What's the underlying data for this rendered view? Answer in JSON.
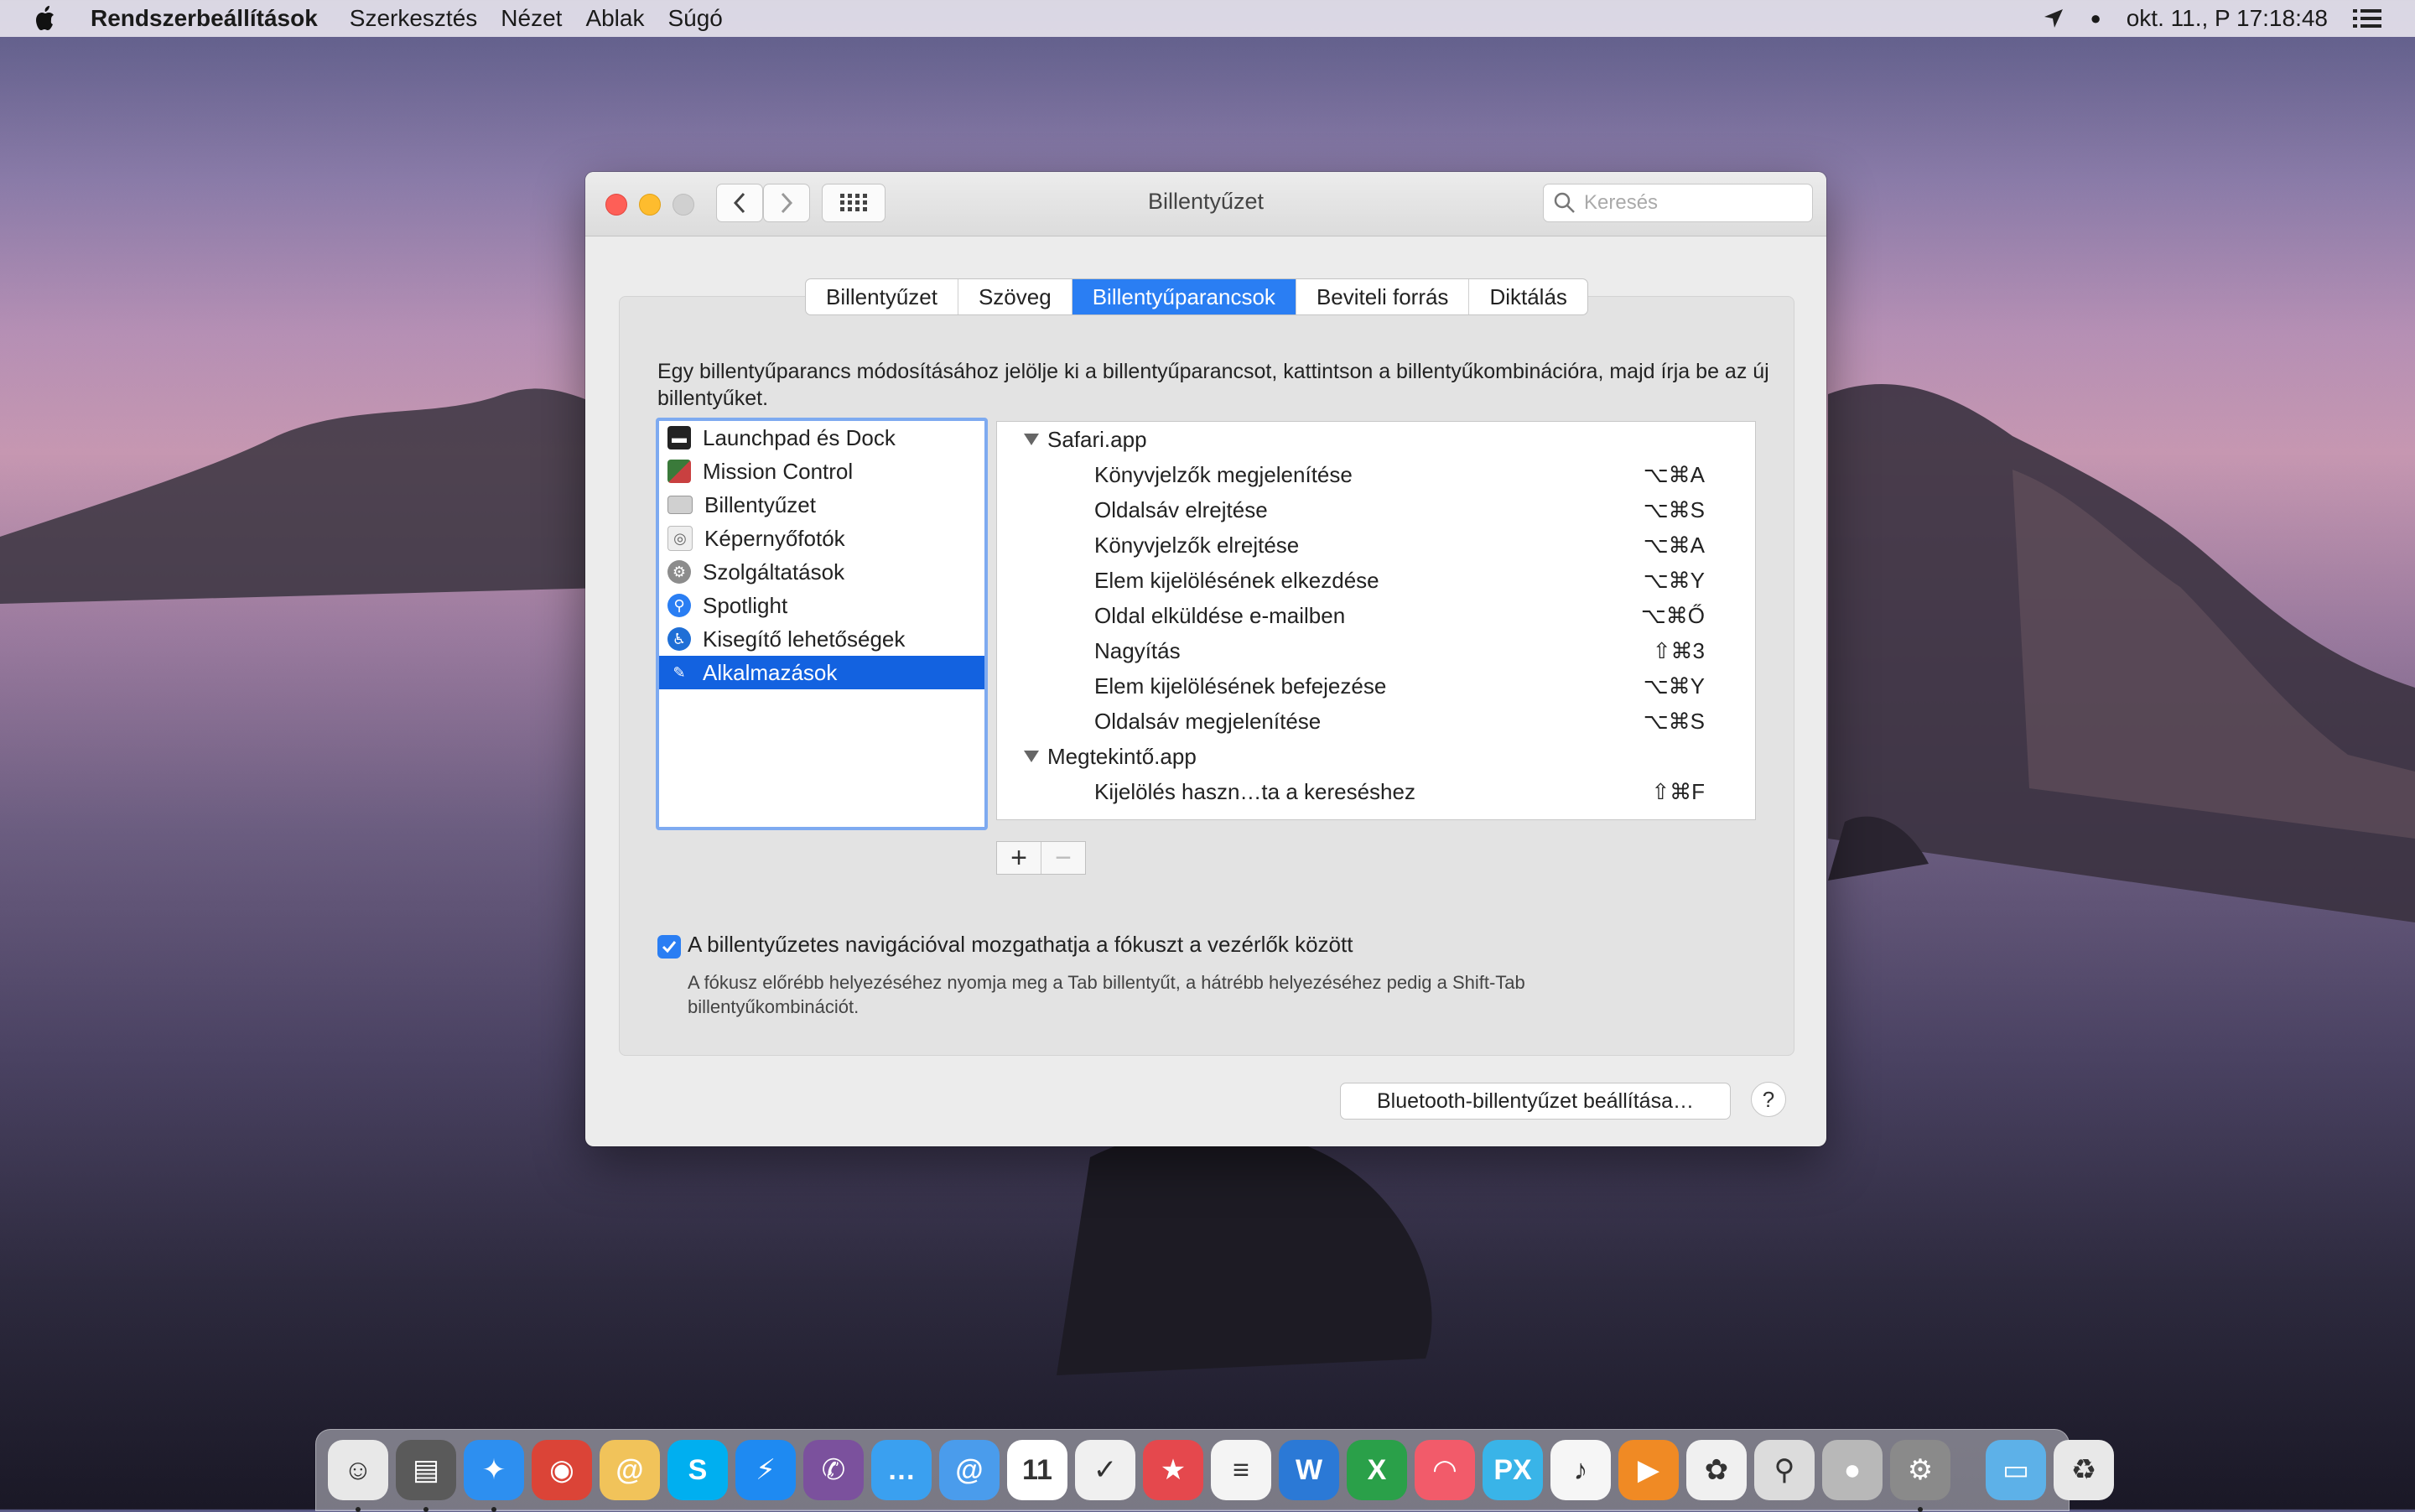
{
  "menubar": {
    "app_name": "Rendszerbeállítások",
    "menus": [
      "Szerkesztés",
      "Nézet",
      "Ablak",
      "Súgó"
    ],
    "clock": "okt. 11., P  17:18:48"
  },
  "window": {
    "title": "Billentyűzet",
    "search_placeholder": "Keresés",
    "tabs": [
      "Billentyűzet",
      "Szöveg",
      "Billentyűparancsok",
      "Beviteli forrás",
      "Diktálás"
    ],
    "active_tab": "Billentyűparancsok",
    "description": "Egy billentyűparancs módosításához jelölje ki a billentyűparancsot, kattintson a billentyűkombinációra, majd írja be az új billentyűket.",
    "categories": [
      {
        "label": "Launchpad és Dock",
        "icon": "launchpad-icon",
        "color": "#222222"
      },
      {
        "label": "Mission Control",
        "icon": "mission-control-icon",
        "color": "#3a7a3a"
      },
      {
        "label": "Billentyűzet",
        "icon": "keyboard-icon",
        "color": "#bdbdbd"
      },
      {
        "label": "Képernyőfotók",
        "icon": "screenshot-icon",
        "color": "#d8d8d8"
      },
      {
        "label": "Szolgáltatások",
        "icon": "gear-icon",
        "color": "#8c8c8c"
      },
      {
        "label": "Spotlight",
        "icon": "spotlight-icon",
        "color": "#2a7ef3"
      },
      {
        "label": "Kisegítő lehetőségek",
        "icon": "accessibility-icon",
        "color": "#1f6fd6"
      },
      {
        "label": "Alkalmazások",
        "icon": "app-store-icon",
        "color": "#3a88ee"
      }
    ],
    "selected_category": "Alkalmazások",
    "shortcuts": [
      {
        "type": "group",
        "label": "Safari.app"
      },
      {
        "type": "item",
        "label": "Könyvjelzők megjelenítése",
        "key": "⌥⌘A"
      },
      {
        "type": "item",
        "label": "Oldalsáv elrejtése",
        "key": "⌥⌘S"
      },
      {
        "type": "item",
        "label": "Könyvjelzők elrejtése",
        "key": "⌥⌘A"
      },
      {
        "type": "item",
        "label": "Elem kijelölésének elkezdése",
        "key": "⌥⌘Y"
      },
      {
        "type": "item",
        "label": "Oldal elküldése e-mailben",
        "key": "⌥⌘Ő"
      },
      {
        "type": "item",
        "label": "Nagyítás",
        "key": "⇧⌘3"
      },
      {
        "type": "item",
        "label": "Elem kijelölésének befejezése",
        "key": "⌥⌘Y"
      },
      {
        "type": "item",
        "label": "Oldalsáv megjelenítése",
        "key": "⌥⌘S"
      },
      {
        "type": "group",
        "label": "Megtekintő.app"
      },
      {
        "type": "item",
        "label": "Kijelölés haszn…ta a kereséshez",
        "key": "⇧⌘F"
      }
    ],
    "add_label": "+",
    "remove_label": "−",
    "checkbox_label": "A billentyűzetes navigációval mozgathatja a fókuszt a vezérlők között",
    "checkbox_checked": true,
    "checkbox_help": "A fókusz előrébb helyezéséhez nyomja meg a Tab billentyűt, a hátrébb helyezéséhez pedig a Shift-Tab billentyűkombinációt.",
    "bluetooth_button": "Bluetooth-billentyűzet beállítása…",
    "help_button": "?"
  },
  "dock": [
    {
      "name": "finder-icon",
      "color": "#e8e8e8",
      "glyph": "☺",
      "running": true
    },
    {
      "name": "disk-utility-icon",
      "color": "#5a5a5a",
      "glyph": "▤",
      "running": true
    },
    {
      "name": "safari-icon",
      "color": "#2d8ff0",
      "glyph": "✦",
      "running": true
    },
    {
      "name": "chrome-icon",
      "color": "#db4437",
      "glyph": "◉",
      "running": false
    },
    {
      "name": "mail-stamp-icon",
      "color": "#f1c35a",
      "glyph": "@",
      "running": false
    },
    {
      "name": "skype-icon",
      "color": "#00aff0",
      "glyph": "S",
      "running": false
    },
    {
      "name": "messenger-icon",
      "color": "#1e8af2",
      "glyph": "⚡",
      "running": false
    },
    {
      "name": "viber-icon",
      "color": "#7b519d",
      "glyph": "✆",
      "running": false
    },
    {
      "name": "messages-icon",
      "color": "#3aa0f0",
      "glyph": "…",
      "running": false
    },
    {
      "name": "mail-icon",
      "color": "#4a9cec",
      "glyph": "@",
      "running": false
    },
    {
      "name": "calendar-icon",
      "color": "#ffffff",
      "glyph": "11",
      "running": false
    },
    {
      "name": "tasks-icon",
      "color": "#f0f0f0",
      "glyph": "✓",
      "running": false
    },
    {
      "name": "reeder-icon",
      "color": "#e5484d",
      "glyph": "★",
      "running": false
    },
    {
      "name": "text-editor-icon",
      "color": "#f4f4f4",
      "glyph": "≡",
      "running": false
    },
    {
      "name": "word-icon",
      "color": "#2b79d6",
      "glyph": "W",
      "running": false
    },
    {
      "name": "excel-icon",
      "color": "#2aa049",
      "glyph": "X",
      "running": false
    },
    {
      "name": "lips-icon",
      "color": "#f25b6a",
      "glyph": "◠",
      "running": false
    },
    {
      "name": "pixelmator-icon",
      "color": "#39b4e8",
      "glyph": "PX",
      "running": false
    },
    {
      "name": "music-icon",
      "color": "#f6f6f6",
      "glyph": "♪",
      "running": false
    },
    {
      "name": "infuse-icon",
      "color": "#f08a24",
      "glyph": "▶",
      "running": false
    },
    {
      "name": "photos-icon",
      "color": "#f0f0f0",
      "glyph": "✿",
      "running": false
    },
    {
      "name": "search-icon",
      "color": "#dcdcdc",
      "glyph": "⚲",
      "running": false
    },
    {
      "name": "apple-icon",
      "color": "#b8b8b8",
      "glyph": "●",
      "running": false
    },
    {
      "name": "system-preferences-icon",
      "color": "#8a8a8a",
      "glyph": "⚙",
      "running": true
    },
    {
      "name": "folder-icon",
      "color": "#5db1e8",
      "glyph": "▭",
      "running": false
    },
    {
      "name": "trash-icon",
      "color": "#e8e8e8",
      "glyph": "♻",
      "running": false
    }
  ]
}
